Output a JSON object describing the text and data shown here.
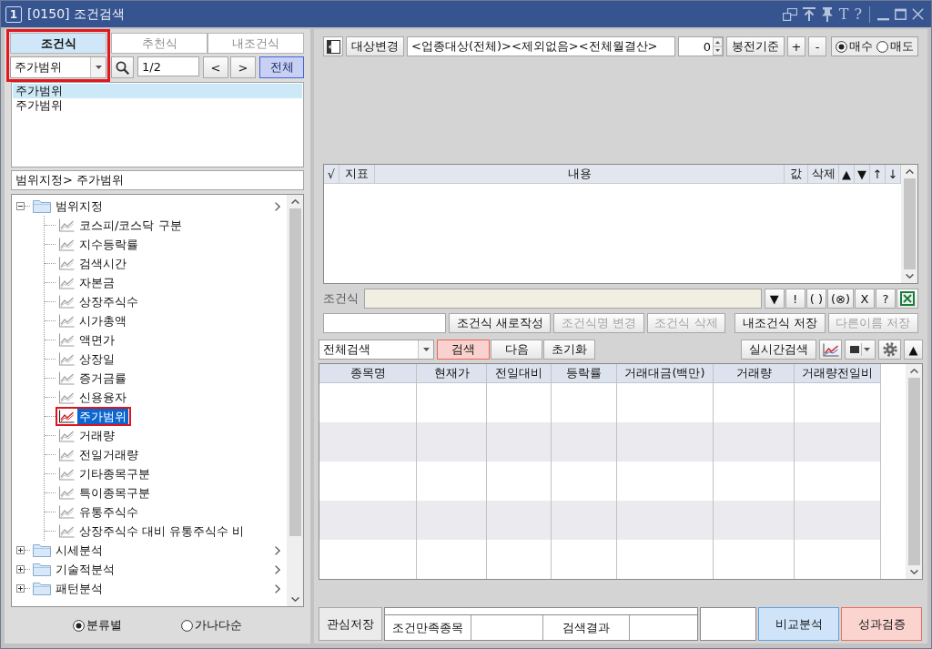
{
  "window": {
    "badge": "1",
    "title": "[0150] 조건검색",
    "title_buttons": [
      "T",
      "?"
    ]
  },
  "left_panel": {
    "tabs": [
      {
        "label": "조건식",
        "selected": true
      },
      {
        "label": "추천식",
        "selected": false
      },
      {
        "label": "내조건식",
        "selected": false
      }
    ],
    "selector_highlighted": true,
    "formula_dropdown": {
      "value": "주가범위"
    },
    "page_field": {
      "value": "1/2"
    },
    "page_buttons": [
      "<",
      ">"
    ],
    "all_button": {
      "label": "전체",
      "color": "#c8d1f3"
    },
    "formula_list": [
      {
        "label": "주가범위",
        "selected": true
      },
      {
        "label": "주가범위",
        "selected": false
      }
    ],
    "breadcrumb": "범위지정> 주가범위",
    "tree": [
      {
        "label": "범위지정",
        "expanded": true,
        "selected": false,
        "highlighted": false,
        "children": [
          {
            "label": "코스피/코스닥 구분",
            "selected": false,
            "highlighted": false
          },
          {
            "label": "지수등락률",
            "selected": false,
            "highlighted": false
          },
          {
            "label": "검색시간",
            "selected": false,
            "highlighted": false
          },
          {
            "label": "자본금",
            "selected": false,
            "highlighted": false
          },
          {
            "label": "상장주식수",
            "selected": false,
            "highlighted": false
          },
          {
            "label": "시가총액",
            "selected": false,
            "highlighted": false
          },
          {
            "label": "액면가",
            "selected": false,
            "highlighted": false
          },
          {
            "label": "상장일",
            "selected": false,
            "highlighted": false
          },
          {
            "label": "증거금률",
            "selected": false,
            "highlighted": false
          },
          {
            "label": "신용융자",
            "selected": false,
            "highlighted": false
          },
          {
            "label": "주가범위",
            "selected": true,
            "highlighted": true
          },
          {
            "label": "거래량",
            "selected": false,
            "highlighted": false
          },
          {
            "label": "전일거래량",
            "selected": false,
            "highlighted": false
          },
          {
            "label": "기타종목구분",
            "selected": false,
            "highlighted": false
          },
          {
            "label": "특이종목구분",
            "selected": false,
            "highlighted": false
          },
          {
            "label": "유통주식수",
            "selected": false,
            "highlighted": false
          },
          {
            "label": "상장주식수 대비 유통주식수 비",
            "selected": false,
            "highlighted": false
          }
        ]
      },
      {
        "label": "시세분석",
        "expanded": false,
        "selected": false,
        "highlighted": false
      },
      {
        "label": "기술적분석",
        "expanded": false,
        "selected": false,
        "highlighted": false
      },
      {
        "label": "패턴분석",
        "expanded": false,
        "selected": false,
        "highlighted": false
      }
    ],
    "sort_options": [
      {
        "label": "분류별",
        "selected": true
      },
      {
        "label": "가나다순",
        "selected": false
      }
    ]
  },
  "right_panel": {
    "target_button": "대상변경",
    "target_field": {
      "value": "<업종대상(전체)><제외없음><전체월결산>"
    },
    "offset_field": {
      "value": "0"
    },
    "toolbar_buttons": [
      "봉전기준",
      "+",
      "-"
    ],
    "trade_options": [
      {
        "label": "매수",
        "selected": true
      },
      {
        "label": "매도",
        "selected": false
      }
    ],
    "indicator_table": {
      "columns": [
        "√",
        "지표",
        "내용",
        "값",
        "삭제",
        "▲",
        "▼",
        "↑",
        "↓"
      ]
    },
    "formula_label": "조건식",
    "formula_buttons": [
      "▼",
      "!",
      "( )",
      "(⊗)",
      "X",
      "?"
    ],
    "formula_actions": [
      {
        "label": "조건식 새로작성",
        "disabled": false
      },
      {
        "label": "조건식명 변경",
        "disabled": true
      },
      {
        "label": "조건식 삭제",
        "disabled": true
      }
    ],
    "save_actions": [
      {
        "label": "내조건식 저장",
        "disabled": false
      },
      {
        "label": "다른이름 저장",
        "disabled": true
      }
    ],
    "search_scope": {
      "value": "전체검색"
    },
    "search_buttons": [
      {
        "label": "검색",
        "color": "#f9d2cf"
      },
      {
        "label": "다음"
      },
      {
        "label": "초기화"
      }
    ],
    "realtime_button": "실시간검색",
    "collapse_button": "▲",
    "results_table": {
      "columns": [
        "종목명",
        "현재가",
        "전일대비",
        "등락률",
        "거래대금(백만)",
        "거래량",
        "거래량전일비"
      ]
    },
    "watch_save_button": "관심저장",
    "summary_labels": [
      "조건만족종목",
      "검색결과"
    ],
    "analysis_buttons": [
      {
        "label": "비교분석",
        "color": "#cfe4f8"
      },
      {
        "label": "성과검증",
        "color": "#fbd4d0"
      }
    ]
  }
}
